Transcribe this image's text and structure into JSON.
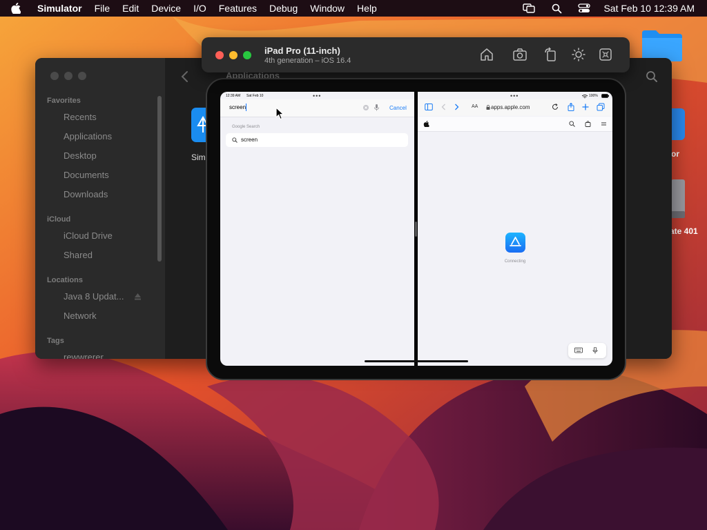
{
  "menubar": {
    "app_name": "Simulator",
    "items": [
      "File",
      "Edit",
      "Device",
      "I/O",
      "Features",
      "Debug",
      "Window",
      "Help"
    ],
    "clock": "Sat Feb 10  12:39 AM",
    "icons": [
      "apple-icon",
      "screen-mirroring-icon",
      "search-icon",
      "control-center-icon"
    ]
  },
  "finder": {
    "title": "Applications",
    "sections": {
      "favorites": "Favorites",
      "icloud": "iCloud",
      "locations": "Locations",
      "tags": "Tags"
    },
    "favorites": [
      "Recents",
      "Applications",
      "Desktop",
      "Documents",
      "Downloads"
    ],
    "icloud_items": [
      "iCloud Drive",
      "Shared"
    ],
    "locations_items": [
      "Java 8 Updat...",
      "Network"
    ],
    "tags_items": [
      "rewwrerer"
    ],
    "app_label": "Sim"
  },
  "desktop": {
    "label_1": "or",
    "label_2": "ate 401"
  },
  "simulator": {
    "device_name": "iPad Pro (11-inch)",
    "device_sub": "4th generation – iOS 16.4",
    "toolbar_icons": [
      "home-icon",
      "screenshot-icon",
      "rotate-icon",
      "brightness-icon",
      "keyboard-command-icon"
    ]
  },
  "ipad": {
    "left": {
      "status_time": "12:39 AM",
      "status_date": "Sat Feb 10",
      "search_query": "screen",
      "cancel_label": "Cancel",
      "suggestions_header": "Google Search",
      "suggestion": "screen"
    },
    "right": {
      "battery": "100%",
      "aa_label": "AA",
      "url": "apps.apple.com",
      "connecting_label": "Connecting"
    }
  },
  "colors": {
    "accent_blue": "#1a7cf5",
    "traffic_red": "#ff5f57",
    "traffic_yellow": "#febc2e",
    "traffic_green": "#28c840"
  }
}
